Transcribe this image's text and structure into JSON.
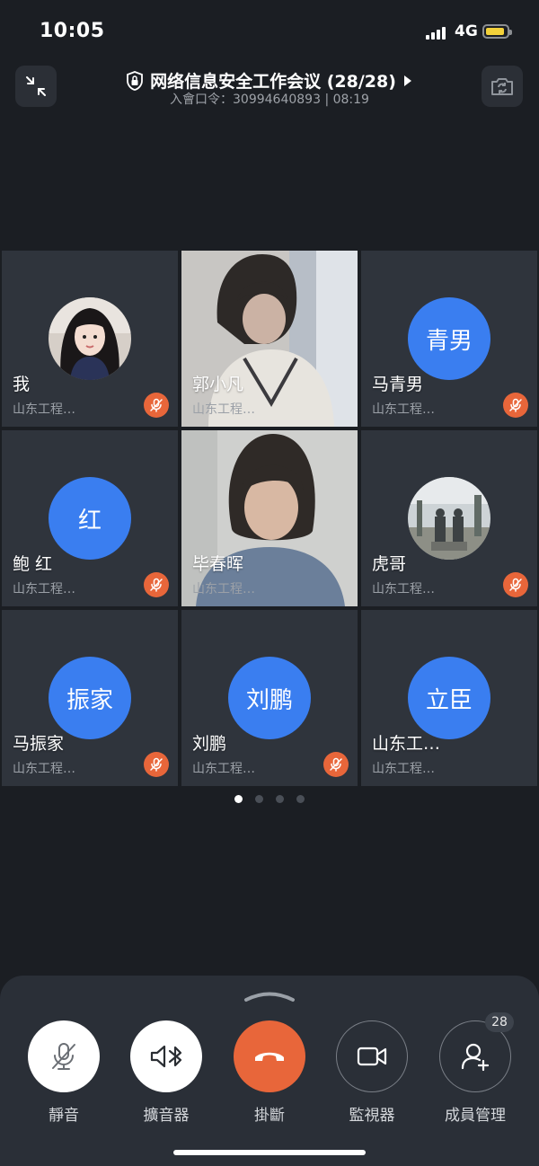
{
  "status_bar": {
    "time": "10:05",
    "network": "4G",
    "battery_color": "#f3d13a"
  },
  "header": {
    "title": "网络信息安全工作会议 (28/28)",
    "subtitle": "入會口令：30994640893 | 08:19",
    "left_icon": "shrink-icon",
    "right_icon": "camera-switch-icon"
  },
  "participants": [
    {
      "name": "我",
      "org": "山东工程…",
      "avatar": "photo",
      "muted": true
    },
    {
      "name": "郭小凡",
      "org": "山东工程…",
      "avatar": "video",
      "muted": false
    },
    {
      "name": "马青男",
      "org": "山东工程…",
      "avatar_text": "青男",
      "muted": true
    },
    {
      "name": "鲍  红",
      "org": "山东工程…",
      "avatar_text": "红",
      "muted": true
    },
    {
      "name": "毕春晖",
      "org": "山东工程…",
      "avatar": "video",
      "muted": false
    },
    {
      "name": "虎哥",
      "org": "山东工程…",
      "avatar": "photo",
      "muted": true
    },
    {
      "name": "马振家",
      "org": "山东工程…",
      "avatar_text": "振家",
      "muted": true
    },
    {
      "name": "刘鹏",
      "org": "山东工程…",
      "avatar_text": "刘鹏",
      "muted": true
    },
    {
      "name": "山东工…",
      "org": "山东工程…",
      "avatar_text": "立臣",
      "muted": false
    }
  ],
  "pagination": {
    "pages": 4,
    "current": 1
  },
  "controls": {
    "mute_label": "靜音",
    "speaker_label": "擴音器",
    "hangup_label": "掛斷",
    "video_label": "監視器",
    "members_label": "成員管理",
    "members_count": "28"
  },
  "colors": {
    "accent_blue": "#3a7ef0",
    "hangup_red": "#e8663a",
    "background": "#1b1e23"
  }
}
